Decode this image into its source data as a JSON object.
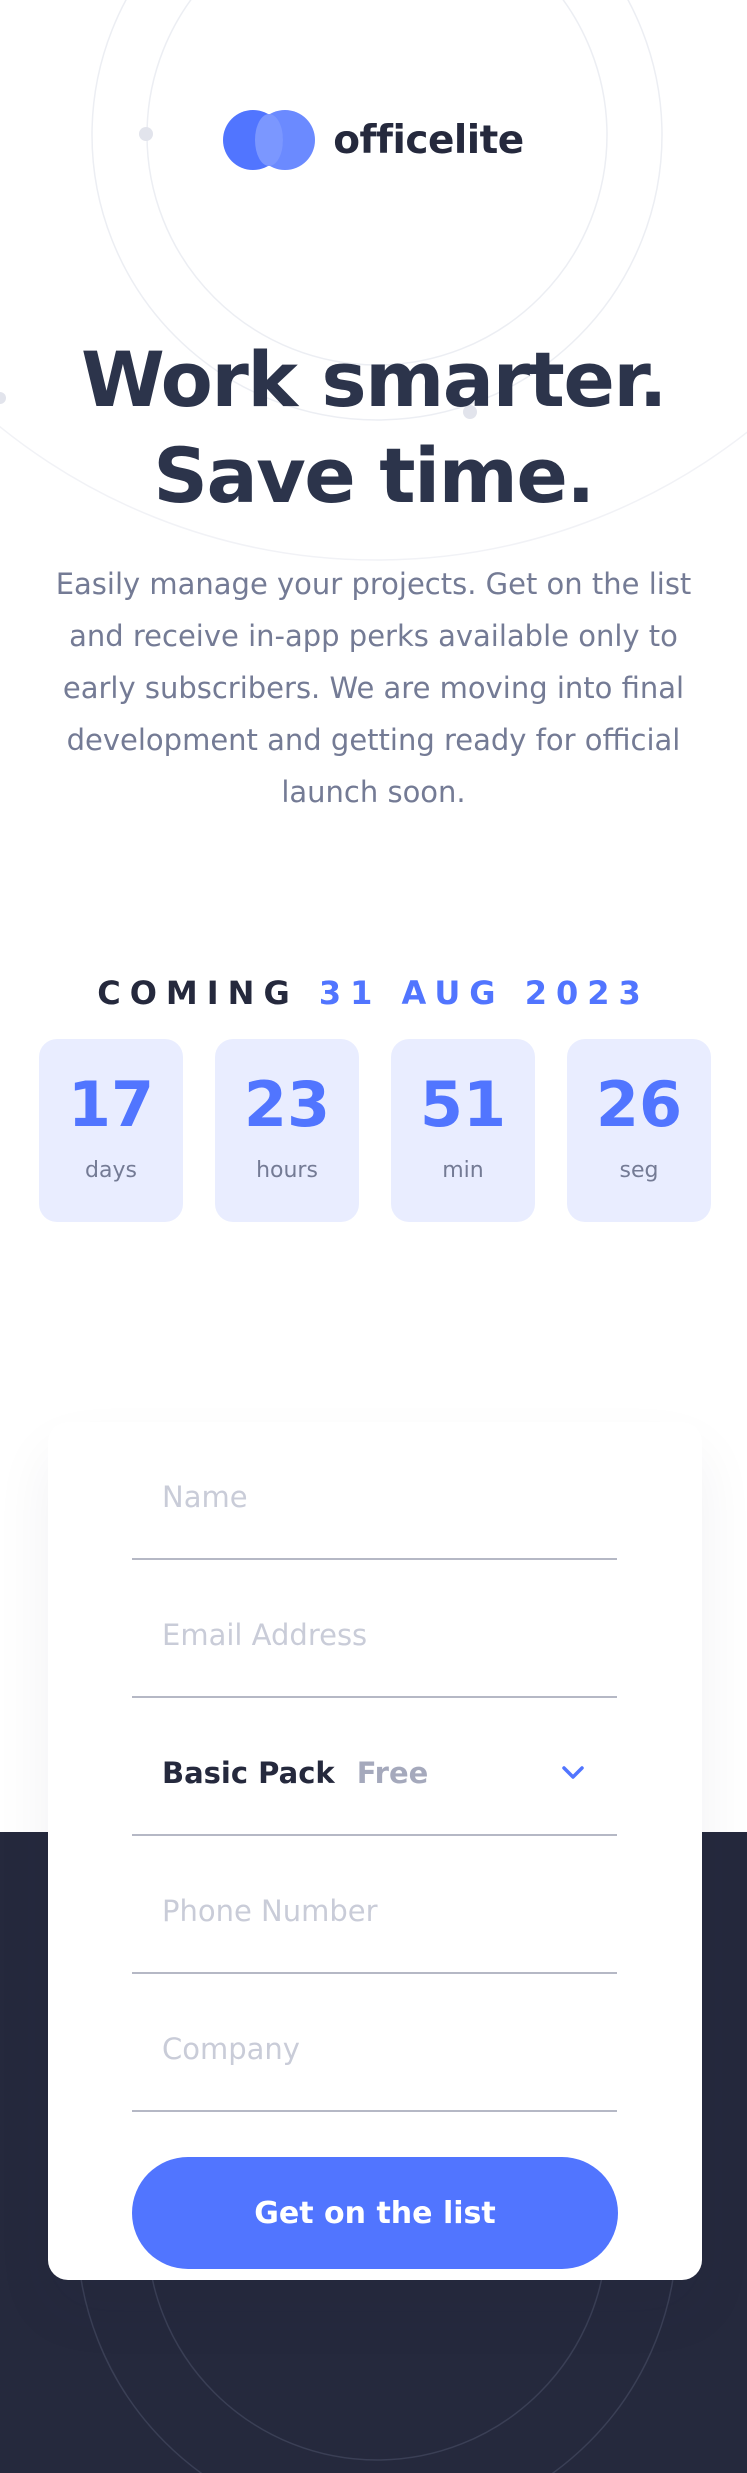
{
  "brand": {
    "name": "officelite"
  },
  "hero": {
    "title_line1": "Work smarter.",
    "title_line2": "Save time.",
    "description": "Easily manage your projects. Get on the list and receive in-app perks available only to early subscribers. We are moving into final development and getting ready for official launch soon."
  },
  "coming": {
    "label": "COMING",
    "date": "31 AUG 2023"
  },
  "countdown": [
    {
      "value": "17",
      "unit": "days"
    },
    {
      "value": "23",
      "unit": "hours"
    },
    {
      "value": "51",
      "unit": "min"
    },
    {
      "value": "26",
      "unit": "seg"
    }
  ],
  "form": {
    "name_placeholder": "Name",
    "email_placeholder": "Email Address",
    "pack": {
      "name": "Basic Pack",
      "price": "Free"
    },
    "phone_placeholder": "Phone Number",
    "company_placeholder": "Company",
    "submit_label": "Get on the list"
  },
  "colors": {
    "accent": "#5175ff",
    "dark": "#25293d",
    "muted": "#747b95",
    "countdown_bg": "#e9edff"
  },
  "icons": {
    "logo": "officelite-logo-icon",
    "select": "chevron-down-icon"
  }
}
